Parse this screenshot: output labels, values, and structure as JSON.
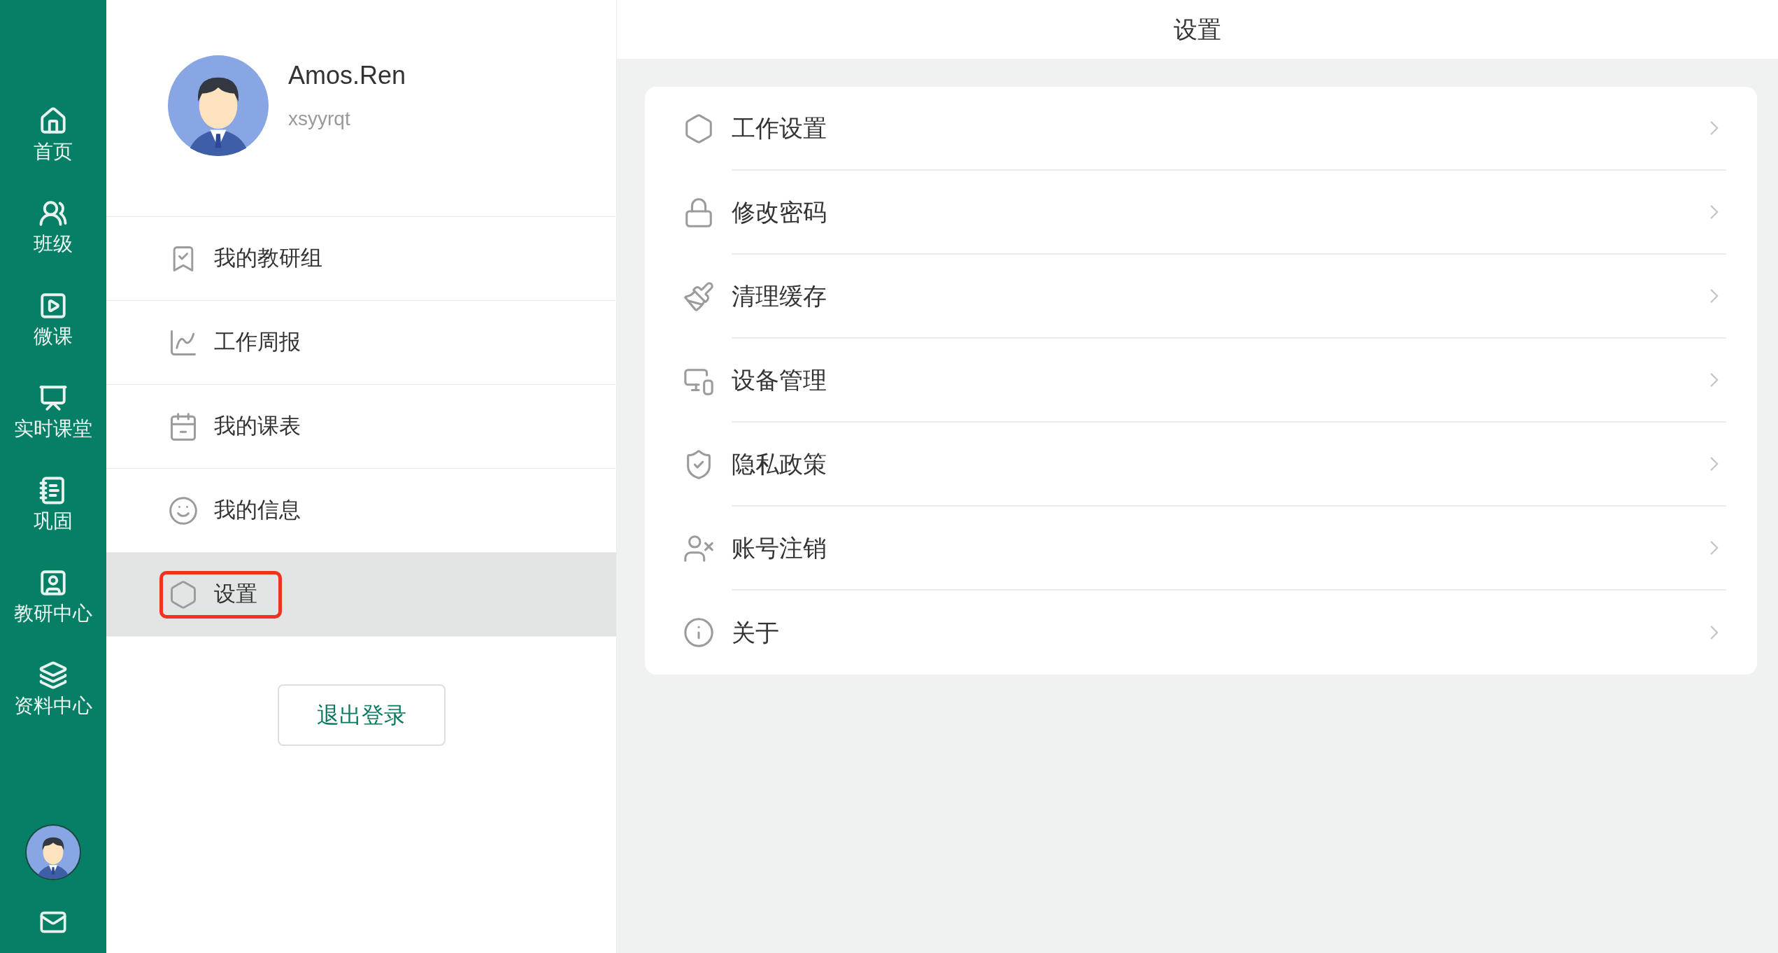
{
  "nav": {
    "items": [
      {
        "label": "首页"
      },
      {
        "label": "班级"
      },
      {
        "label": "微课"
      },
      {
        "label": "实时课堂"
      },
      {
        "label": "巩固"
      },
      {
        "label": "教研中心"
      },
      {
        "label": "资料中心"
      }
    ]
  },
  "profile": {
    "name": "Amos.Ren",
    "username": "xsyyrqt"
  },
  "menu": [
    {
      "label": "我的教研组",
      "selected": false
    },
    {
      "label": "工作周报",
      "selected": false
    },
    {
      "label": "我的课表",
      "selected": false
    },
    {
      "label": "我的信息",
      "selected": false
    },
    {
      "label": "设置",
      "selected": true
    }
  ],
  "logout_button": "退出登录",
  "header": {
    "title": "设置"
  },
  "settings": [
    {
      "label": "工作设置"
    },
    {
      "label": "修改密码"
    },
    {
      "label": "清理缓存"
    },
    {
      "label": "设备管理"
    },
    {
      "label": "隐私政策"
    },
    {
      "label": "账号注销"
    },
    {
      "label": "关于"
    }
  ]
}
